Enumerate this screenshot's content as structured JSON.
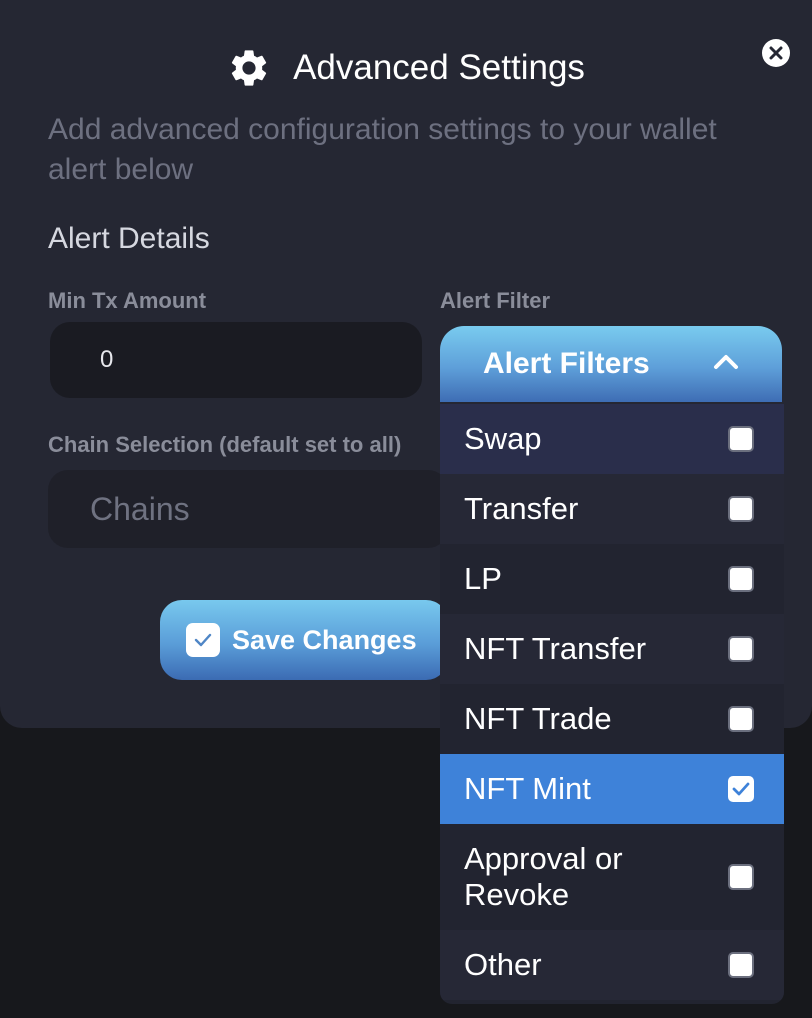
{
  "modal": {
    "title": "Advanced Settings",
    "title_icon": "gear-icon",
    "close_icon": "close-icon",
    "subtitle": "Add advanced configuration settings to your wallet alert below",
    "section_heading": "Alert Details"
  },
  "min_tx": {
    "label": "Min Tx Amount",
    "value": "0"
  },
  "alert_filter": {
    "label": "Alert Filter",
    "header_label": "Alert Filters",
    "expanded": true,
    "options": [
      {
        "label": "Swap",
        "checked": false
      },
      {
        "label": "Transfer",
        "checked": false
      },
      {
        "label": "LP",
        "checked": false
      },
      {
        "label": "NFT Transfer",
        "checked": false
      },
      {
        "label": "NFT Trade",
        "checked": false
      },
      {
        "label": "NFT Mint",
        "checked": true
      },
      {
        "label": "Approval or Revoke",
        "checked": false
      },
      {
        "label": "Other",
        "checked": false
      }
    ]
  },
  "chain_selection": {
    "label": "Chain Selection (default set to all)",
    "placeholder": "Chains"
  },
  "save_button": {
    "label": "Save Changes"
  },
  "colors": {
    "modal_bg": "#252733",
    "accent": "#3e82d9",
    "button_gradient_top": "#78c9ee",
    "button_gradient_bottom": "#3b6bb3"
  }
}
